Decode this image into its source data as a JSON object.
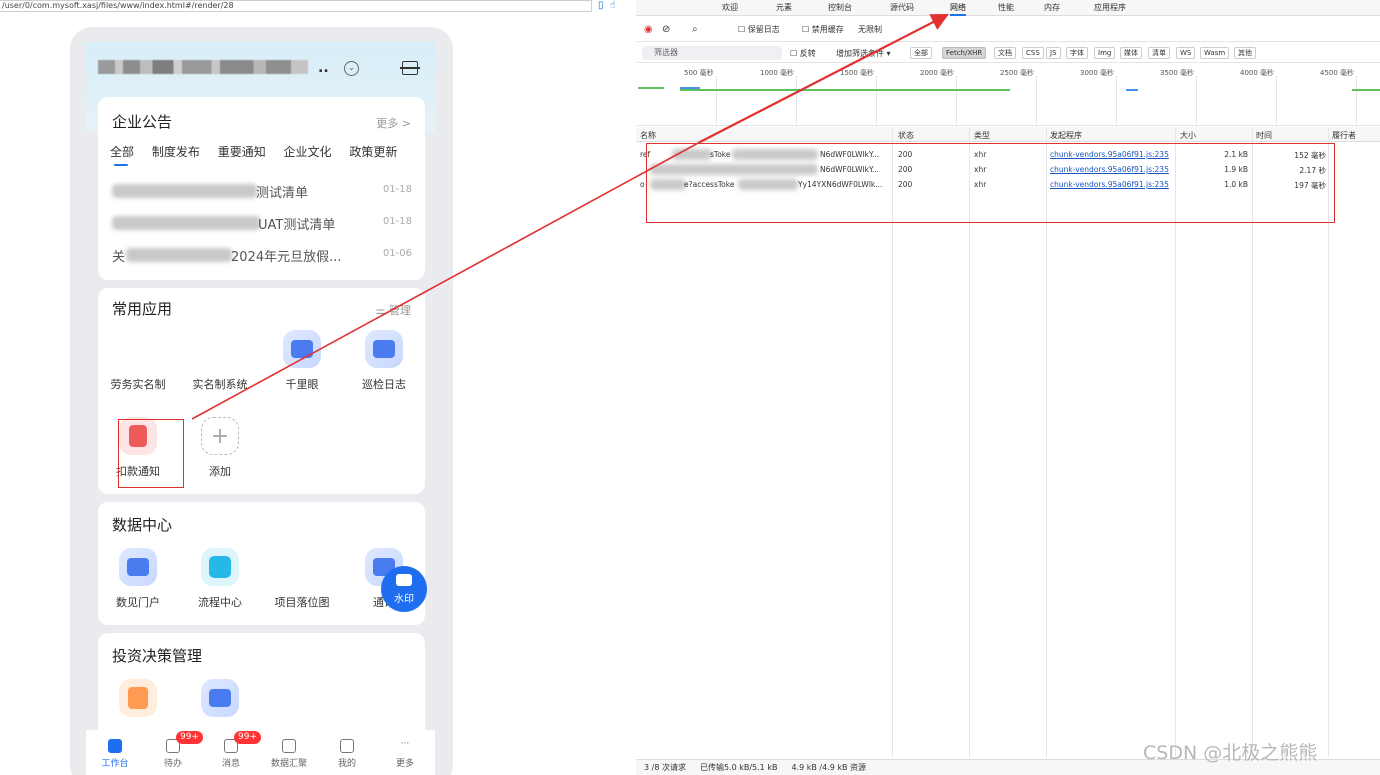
{
  "browser": {
    "url": "/user/0/com.mysoft.xasj/files/www/index.html#/render/28"
  },
  "app": {
    "announcement": {
      "title": "企业公告",
      "more": "更多 >",
      "tabs": [
        "全部",
        "制度发布",
        "重要通知",
        "企业文化",
        "政策更新"
      ],
      "items": [
        {
          "text": "测试清单",
          "date": "01-18"
        },
        {
          "text": "UAT测试清单",
          "date": "01-18"
        },
        {
          "prefix": "关",
          "text": "2024年元旦放假...",
          "date": "01-06"
        }
      ]
    },
    "common_apps": {
      "title": "常用应用",
      "manage": "管理",
      "items": [
        "劳务实名制",
        "实名制系统",
        "千里眼",
        "巡检日志",
        "扣款通知",
        "添加"
      ]
    },
    "data_center": {
      "title": "数据中心",
      "items": [
        "数见门户",
        "流程中心",
        "项目落位图",
        "通讯"
      ]
    },
    "investment": {
      "title": "投资决策管理"
    },
    "watermark": "水印",
    "tabbar": [
      {
        "label": "工作台"
      },
      {
        "label": "待办",
        "badge": "99+"
      },
      {
        "label": "消息",
        "badge": "99+"
      },
      {
        "label": "数据汇聚"
      },
      {
        "label": "我的"
      },
      {
        "label": "更多"
      }
    ]
  },
  "devtools": {
    "tabs": [
      "欢迎",
      "元素",
      "控制台",
      "源代码",
      "网络",
      "性能",
      "内存",
      "应用程序"
    ],
    "active_tab": "网络",
    "toolbar": {
      "preserve_log": "保留日志",
      "disable_cache": "禁用缓存",
      "throttle": "无限制"
    },
    "filter": {
      "placeholder": "筛选器",
      "invert": "反转",
      "more_filters": "增加筛选条件 ▾",
      "chips": [
        "全部",
        "Fetch/XHR",
        "文档",
        "CSS",
        "JS",
        "字体",
        "Img",
        "媒体",
        "清单",
        "WS",
        "Wasm",
        "其他"
      ],
      "selected": "Fetch/XHR"
    },
    "timeline": [
      "500 毫秒",
      "1000 毫秒",
      "1500 毫秒",
      "2000 毫秒",
      "2500 毫秒",
      "3000 毫秒",
      "3500 毫秒",
      "4000 毫秒",
      "4500 毫秒"
    ],
    "columns": [
      "名称",
      "状态",
      "类型",
      "发起程序",
      "大小",
      "时间",
      "履行者"
    ],
    "rows": [
      {
        "name_start": "ref",
        "name_mid": "sToke",
        "name_end": "N6dWF0LWlkY...",
        "status": "200",
        "type": "xhr",
        "initiator": "chunk-vendors.95a06f91.js:235",
        "size": "2.1 kB",
        "time": "152 毫秒"
      },
      {
        "name_start": "",
        "name_mid": "",
        "name_end": "N6dWF0LWlkY...",
        "status": "200",
        "type": "xhr",
        "initiator": "chunk-vendors.95a06f91.js:235",
        "size": "1.9 kB",
        "time": "2.17 秒"
      },
      {
        "name_start": "o",
        "name_mid": "e?accessToke",
        "name_end": "Yy14YXN6dWF0LWlk...",
        "status": "200",
        "type": "xhr",
        "initiator": "chunk-vendors.95a06f91.js:235",
        "size": "1.0 kB",
        "time": "197 毫秒"
      }
    ],
    "status": {
      "requests": "3 /8 次请求",
      "transferred": "已传输5.0 kB/5.1 kB",
      "resources": "4.9 kB /4.9 kB 资源"
    }
  },
  "watermark_text": "CSDN @北极之熊熊",
  "annotation_color": "#e03030"
}
